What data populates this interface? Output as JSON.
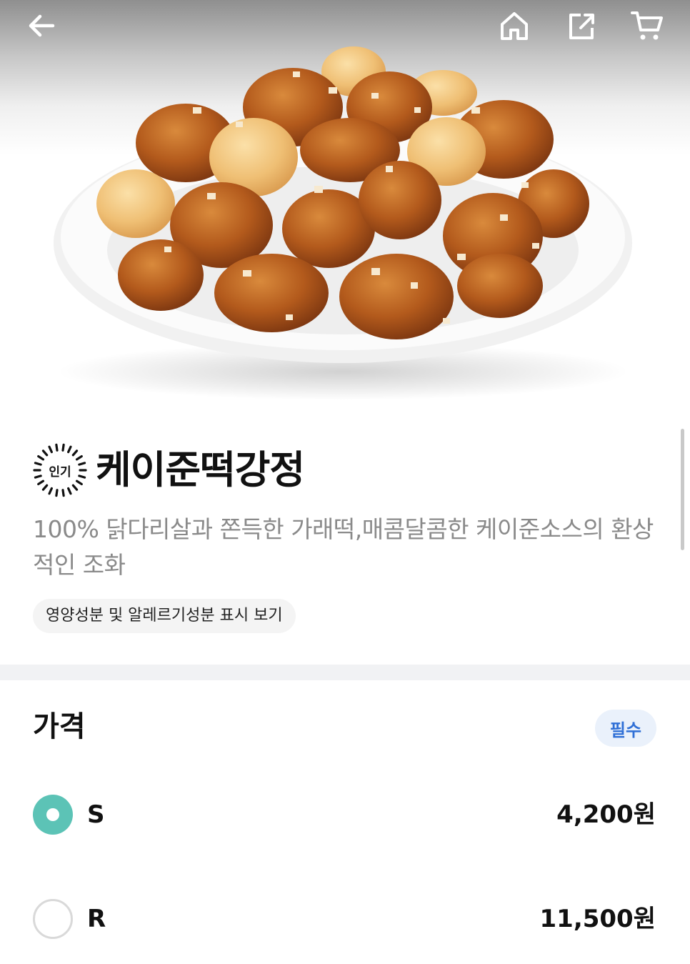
{
  "product": {
    "title": "케이준떡강정",
    "badge": "인기",
    "description": "100% 닭다리살과 쫀득한 가래떡,매콤달콤한 케이준소스의 환상적인 조화",
    "nutrition_button": "영양성분 및 알레르기성분 표시 보기",
    "image_icon": "fried-chicken-photo"
  },
  "header_icons": [
    "back-arrow-icon",
    "home-icon",
    "share-icon",
    "cart-icon"
  ],
  "price_section": {
    "title": "가격",
    "required_badge": "필수",
    "options": [
      {
        "label": "S",
        "price": "4,200원",
        "selected": true
      },
      {
        "label": "R",
        "price": "11,500원",
        "selected": false
      }
    ]
  },
  "colors": {
    "accent": "#5cc3b6",
    "required_text": "#2f6fd6",
    "required_bg": "#eaf1fb",
    "description": "#8a8a8a"
  }
}
